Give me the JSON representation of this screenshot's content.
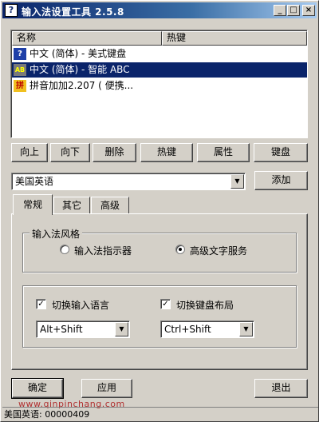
{
  "window": {
    "title": "输入法设置工具 2.5.8",
    "icon": "question-mark-icon",
    "controls": {
      "minimize": "_",
      "maximize": "□",
      "close": "×"
    }
  },
  "list": {
    "columns": [
      "名称",
      "热键"
    ],
    "rows": [
      {
        "icon": "help-icon",
        "name": "中文 (简体) - 美式键盘",
        "selected": false
      },
      {
        "icon": "abc-ime-icon",
        "name": "中文 (简体) - 智能 ABC",
        "selected": true
      },
      {
        "icon": "pinyin-ime-icon",
        "name": "拼音加加2.207 ( 便携...",
        "selected": false
      }
    ]
  },
  "toolbar": {
    "up": "向上",
    "down": "向下",
    "delete": "删除",
    "hotkey": "热键",
    "properties": "属性",
    "keyboard": "键盘"
  },
  "language_select": {
    "value": "美国英语",
    "add": "添加"
  },
  "tabs": [
    {
      "label": "常规",
      "active": true
    },
    {
      "label": "其它",
      "active": false
    },
    {
      "label": "高级",
      "active": false
    }
  ],
  "style_group": {
    "title": "输入法风格",
    "option1": "输入法指示器",
    "option2": "高级文字服务",
    "selected": "option2"
  },
  "switch_group": {
    "lang_label": "切换输入语言",
    "lang_checked": true,
    "lang_hotkey": "Alt+Shift",
    "kb_label": "切换键盘布局",
    "kb_checked": true,
    "kb_hotkey": "Ctrl+Shift"
  },
  "buttons": {
    "ok": "确定",
    "apply": "应用",
    "exit": "退出"
  },
  "status": "美国英语: 00000409",
  "watermark": "www.qinpinchang.com",
  "colors": {
    "title_start": "#0a246a",
    "title_end": "#a6caf0",
    "selection": "#0a246a",
    "face": "#d4d0c8"
  }
}
